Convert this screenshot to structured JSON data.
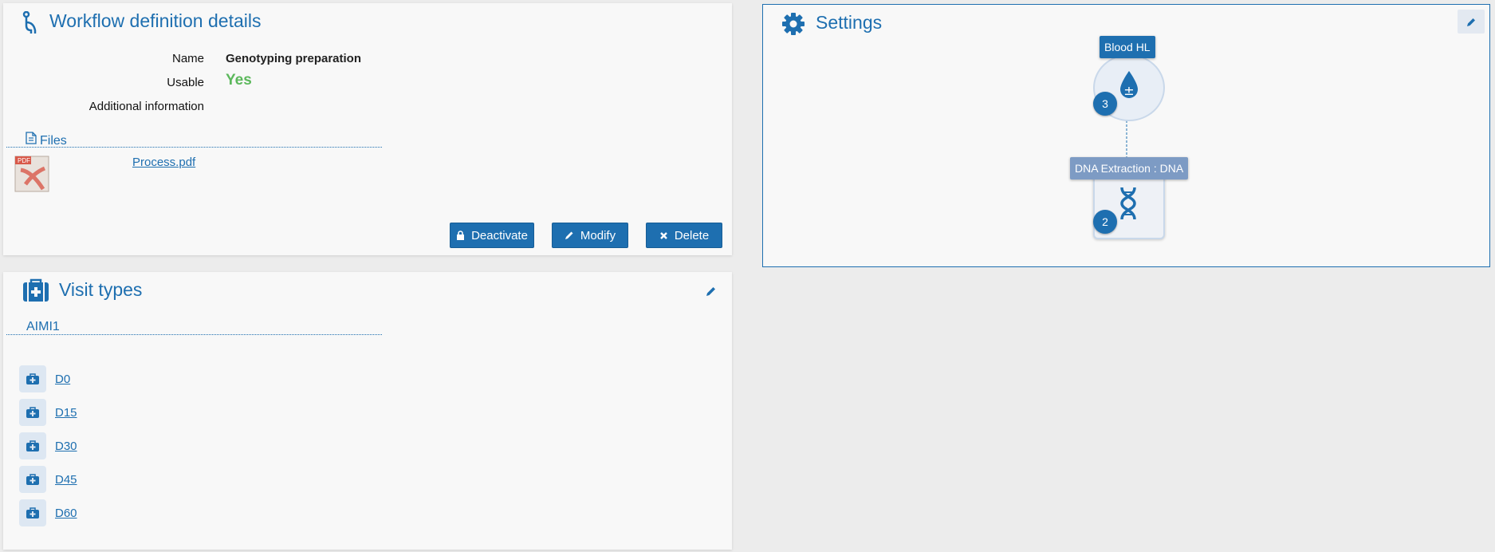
{
  "workflow": {
    "title": "Workflow definition details",
    "fields": [
      {
        "label": "Name",
        "value": "Genotyping preparation"
      },
      {
        "label": "Usable",
        "value": "Yes"
      },
      {
        "label": "Additional information",
        "value": ""
      }
    ],
    "files_heading": "Files",
    "file_name": "Process.pdf",
    "pdf_icon_text": "PDF",
    "buttons": {
      "deactivate": "Deactivate",
      "modify": "Modify",
      "delete": "Delete"
    }
  },
  "visits": {
    "title": "Visit types",
    "group_heading": "AIMI1",
    "items": [
      "D0",
      "D15",
      "D30",
      "D45",
      "D60"
    ]
  },
  "settings": {
    "title": "Settings",
    "nodes": [
      {
        "label": "Blood HL",
        "count": "3",
        "icon": "blood-drop-icon"
      },
      {
        "label": "DNA Extraction : DNA",
        "count": "2",
        "icon": "dna-icon"
      }
    ]
  },
  "colors": {
    "accent": "#1e6fb0",
    "success": "#5cb85c",
    "background": "#ececec",
    "panel": "#f8f8f8"
  }
}
